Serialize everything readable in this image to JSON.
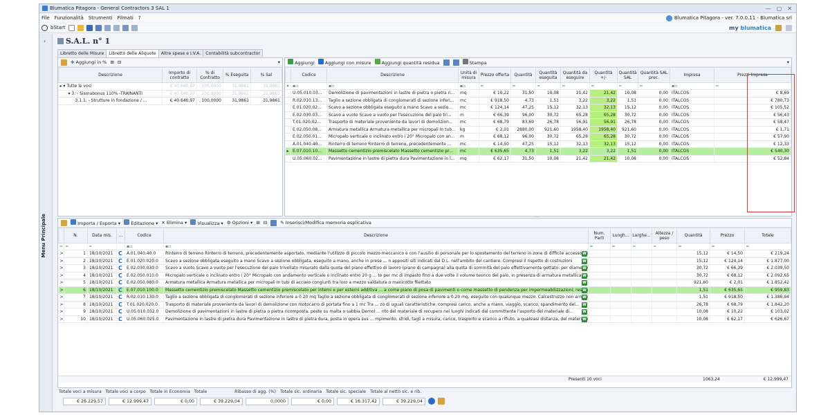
{
  "window": {
    "title": "Blumatica Pitagora - General Contractors 3 SAL 1",
    "controls": [
      "—",
      "▢",
      "✕"
    ]
  },
  "menu": {
    "items": [
      "File",
      "Funzionalità",
      "Strumenti",
      "Filmati",
      "?"
    ],
    "version": "Blumatica Pitagora - ver. 7.0.0.11 - Blumatica srl"
  },
  "toolbar": {
    "start": "bStart",
    "brand_my": "my",
    "brand_name": "blumatica"
  },
  "sidebar": {
    "label": "Menu Principale",
    "chevron": "›"
  },
  "page": {
    "title": "S.A.L. n° 1"
  },
  "tabs": [
    "Libretto delle Misure",
    "Libretto delle Aliquote",
    "Altre spese e I.V.A.",
    "Contabilità subcontractor"
  ],
  "aliquote": {
    "toolbar_add": "Aggiungi in %",
    "headers": [
      "Descrizione",
      "Importo di contratto",
      "% di Contratto",
      "% Eseguita",
      "% Sal"
    ],
    "rows": [
      {
        "desc": "Tutte le voci",
        "importo": "€ 40.640,97",
        "contratto": "100,0000",
        "eseguita": "31,9861",
        "sal": "31,9861"
      },
      {
        "desc": "3. - Sismabonus 110% -TRAINANTI",
        "importo": "€ 40.640,97",
        "contratto": "100,0000",
        "eseguita": "31,9861",
        "sal": "31,9861"
      },
      {
        "desc": "3.1.1. - Strutture in fondazione / ...",
        "importo": "€ 40.640,97",
        "contratto": "100,0000",
        "eseguita": "31,9861",
        "sal": "31,9861"
      }
    ]
  },
  "voci": {
    "toolbar": {
      "add": "Aggiungi",
      "add_misure": "Aggiungi con misure",
      "add_residua": "Aggiungi quantità residua",
      "print": "Stampa"
    },
    "headers": [
      "Codice",
      "Descrizione",
      "Unità di misura",
      "Prezzo offerta",
      "Quantità",
      "Quantità eseguita",
      "Quantità da eseguire",
      "Quantità +/-",
      "Quantità SAL",
      "Quantità SAL prec.",
      "Impresa",
      "Prezzi Impresa"
    ],
    "rows": [
      {
        "codice": "U.05.010.03...",
        "desc": "Demolizione di pavimentazioni in lastre di pietra o pietra ri...",
        "um": "mq",
        "prezzo": "€ 10,22",
        "q": "31,50",
        "qe": "10,08",
        "qde": "21,42",
        "qpm": "21,42",
        "qsal": "10,08",
        "qprec": "0,00",
        "impresa": "ITALCOS",
        "pi": "€ 8,69"
      },
      {
        "codice": "R.02.010.13...",
        "desc": "Taglio a sezione obbligata di conglomerati di sezione inferi...",
        "um": "mc",
        "prezzo": "€ 918,50",
        "q": "4,73",
        "qe": "1,51",
        "qde": "3,22",
        "qpm": "3,22",
        "qsal": "1,51",
        "qprec": "0,00",
        "impresa": "ITALCOS",
        "pi": "€ 780,73"
      },
      {
        "codice": "E.01.020.02...",
        "desc": "Scavo a sezione obbligata eseguito a mano Scavo a sezio...",
        "um": "mc",
        "prezzo": "€ 124,14",
        "q": "47,25",
        "qe": "15,12",
        "qde": "32,13",
        "qpm": "32,13",
        "qsal": "15,12",
        "qprec": "0,00",
        "impresa": "ITALCOS",
        "pi": "€ 105,52"
      },
      {
        "codice": "E.02.030.03...",
        "desc": "Scavo a vuoto Scavo a vuoto per l'esecuzione del palo tri...",
        "um": "m",
        "prezzo": "€ 66,39",
        "q": "96,00",
        "qe": "30,72",
        "qde": "65,28",
        "qpm": "65,28",
        "qsal": "30,72",
        "qprec": "0,00",
        "impresa": "ITALCOS",
        "pi": "€ 56,43"
      },
      {
        "codice": "T.01.020.02...",
        "desc": "Trasporto di materiale proveniente da lavori di demolizion...",
        "um": "mc",
        "prezzo": "€ 68,79",
        "q": "83,69",
        "qe": "26,78",
        "qde": "56,91",
        "qpm": "56,91",
        "qsal": "26,78",
        "qprec": "0,00",
        "impresa": "ITALCOS",
        "pi": "€ 58,47"
      },
      {
        "codice": "E.02.050.08...",
        "desc": "Armatura metallica Armatura metallica per micropali In tub...",
        "um": "kg",
        "prezzo": "€ 2,01",
        "q": "2880,00",
        "qe": "921,60",
        "qde": "1958,40",
        "qpm": "1958,40",
        "qsal": "921,60",
        "qprec": "0,00",
        "impresa": "ITALCOS",
        "pi": "€ 1,71"
      },
      {
        "codice": "E.02.050.01...",
        "desc": "Micropalo verticale o inclinato entro i 20° Micropalo con an...",
        "um": "m",
        "prezzo": "€ 68,12",
        "q": "96,00",
        "qe": "30,72",
        "qde": "65,28",
        "qpm": "65,28",
        "qsal": "30,72",
        "qprec": "0,00",
        "impresa": "ITALCOS",
        "pi": "€ 57,90"
      },
      {
        "codice": "A.01.040.40...",
        "desc": "Rinterro di terreno Rinterro di terreno, precedentemente ...",
        "um": "mc",
        "prezzo": "€ 14,50",
        "q": "47,25",
        "qe": "15,12",
        "qde": "32,13",
        "qpm": "32,13",
        "qsal": "15,12",
        "qprec": "0,00",
        "impresa": "ITALCOS",
        "pi": "€ 12,33"
      },
      {
        "codice": "E.07.010.10...",
        "desc": "Massetto cementizio premiscelato Massetto cementizio pr...",
        "um": "mc",
        "prezzo": "€ 635,65",
        "q": "4,73",
        "qe": "1,51",
        "qde": "3,22",
        "qpm": "3,22",
        "qsal": "1,51",
        "qprec": "0,00",
        "impresa": "ITALCOS",
        "pi": "€ 540,30"
      },
      {
        "codice": "U.05.060.02...",
        "desc": "Pavimentazione in lastre di pietra dura Pavimentazione in l...",
        "um": "mq",
        "prezzo": "€ 62,17",
        "q": "31,50",
        "qe": "10,08",
        "qde": "21,42",
        "qpm": "21,42",
        "qsal": "10,08",
        "qprec": "0,00",
        "impresa": "ITALCOS",
        "pi": "€ 52,84"
      }
    ]
  },
  "misure": {
    "toolbar": {
      "import": "Importa / Esporta",
      "edit": "Editazione",
      "delete": "Elimina",
      "view": "Visualizza",
      "options": "Opzioni",
      "memo": "Inserisci/Modifica memoria esplicativa"
    },
    "headers": [
      "N.",
      "Data mis.",
      "...",
      "Codice",
      "Descrizione",
      "Num. Parti",
      "Lungh...",
      "Larghe...",
      "Altezza / peso",
      "Quantità",
      "Prezzo",
      "Totale"
    ],
    "rows": [
      {
        "n": "1",
        "data": "18/10/2021",
        "codice": "A.01.040.40.0",
        "desc": "Rinterro di terreno Rinterro di terreno, precedentemente asportato, mediante l'utilizzo di piccolo mezzo meccanico e con l'ausilio di personale per lo spostamento del terreno in zone di difficile accesso per",
        "q": "15,12",
        "prezzo": "€ 14,50",
        "tot": "€ 219,24"
      },
      {
        "n": "2",
        "data": "18/10/2021",
        "codice": "E.01.020.020.0",
        "desc": "Scavo a sezione obbligata eseguito a mano Scavo a sezione obbligata, eseguito a mano, anche in prese ... n appositi siti indicati dal D.L. nell'ambito del cantiere. Compresi il rispetto di costruzioni",
        "q": "15,12",
        "prezzo": "€ 124,14",
        "tot": "€ 1.877,00"
      },
      {
        "n": "3",
        "data": "18/10/2021",
        "codice": "E.02.030.030.0",
        "desc": "Scavo a vuoto Scavo a vuoto per l'esecuzione del palo trivellato misurato dalla quota del piano effettivo di lavoro (piano di campagna) alla quota di sommità del palo effettivamente gettato: per diametro",
        "q": "30,72",
        "prezzo": "€ 66,39",
        "tot": "€ 2.039,50"
      },
      {
        "n": "4",
        "data": "18/10/2021",
        "codice": "E.02.050.010.0",
        "desc": "Micropalo verticale o inclinato entro i 20° Micropalo con andamento verticale o inclinato entro 20 g ... to per mc di impasto fino a due volte il volume teorico del palo, in presenza di armatura metallica (da",
        "q": "30,72",
        "prezzo": "€ 68,12",
        "tot": "€ 2.092,65"
      },
      {
        "n": "5",
        "data": "18/10/2021",
        "codice": "E.02.050.080.0",
        "desc": "Armatura metallica Armatura metallica per micropali In tubi di acciaio congiunti tra loro a mezzo saldatura o manicotto filettato",
        "q": "921,60",
        "prezzo": "€ 2,01",
        "tot": "€ 1.852,42"
      },
      {
        "n": "6",
        "data": "18/10/2021",
        "codice": "E.07.010.100.0",
        "desc": "Massetto cementizio premiscelato Massetto cementizio premiscelato per interni e per esterni additiva ... a come piano di posa di pavimenti o come massetto di pendenza per impermeabilizzazioni; resistenza",
        "q": "1,51",
        "prezzo": "€ 635,65",
        "tot": "€ 959,83"
      },
      {
        "n": "7",
        "data": "18/10/2021",
        "codice": "R.02.010.130.0",
        "desc": "Taglio a sezione obbligata di conglomerati di sezione inferiore a 0.20 mq Taglio a sezione obbligata di conglomerati di sezione inferiore a 0.20 mq, eseguito con qualunque mezzo. Calcestruzzo non armato",
        "q": "1,51",
        "prezzo": "€ 918,50",
        "tot": "€ 1.386,94"
      },
      {
        "n": "8",
        "data": "18/10/2021",
        "codice": "T.01.020.020.0",
        "desc": "Trasporto di materiale proveniente da lavori di demolizione con motocarro di portata fino a 1 mc Tra ... zo di uguali caratteristiche, compresi carico, anche a mano, viaggio, scarico, spandimento del...",
        "q": "26,78",
        "prezzo": "€ 68,79",
        "tot": "€ 1.842,20"
      },
      {
        "n": "9",
        "data": "18/10/2021",
        "codice": "U.05.010.032.0",
        "desc": "Demolizione di pavimentazioni in lastre di pietra o pietra ricomposta, poste su malta o sabbia Demol ... nto del materiale di recupero nei luoghi indicati dal committente l'asporto del materiale di...",
        "q": "10,08",
        "prezzo": "€ 10,22",
        "tot": "€ 103,02"
      },
      {
        "n": "10",
        "data": "18/10/2021",
        "codice": "U.05.060.025.0",
        "desc": "Pavimentazione in lastre di pietra dura Pavimentazione in lastre di pietra dura, posta in opera sus ... mpimento, sfridi, tagli a misura, carico, trasporto e scarico a rifiuto, a qualsiasi distanza, del materiale",
        "q": "10,08",
        "prezzo": "€ 62,17",
        "tot": "€ 626,67"
      }
    ],
    "summary": {
      "presenti": "Presenti 10 voci",
      "quantita": "1063,24",
      "totale": "€ 12.999,47"
    }
  },
  "footer": {
    "labels": [
      "Totale voci a misura",
      "Totale voci a corpo",
      "Totale in Economia",
      "Totale",
      "Ribasso di agg. (%)",
      "Totale sic. ordinaria",
      "Totale sic. speciale",
      "Totale al netto sic. e rib."
    ],
    "values": [
      "€ 26.229,57",
      "€ 12.999,47",
      "€ 0,00",
      "€ 39.229,04",
      "0,0000",
      "€ 0,00",
      "€ 16.317,42",
      "€ 39.229,04"
    ]
  },
  "colors": {
    "highlight": "#b8f07e",
    "selected": "#b5ee9f",
    "redbox": "#e03434"
  }
}
